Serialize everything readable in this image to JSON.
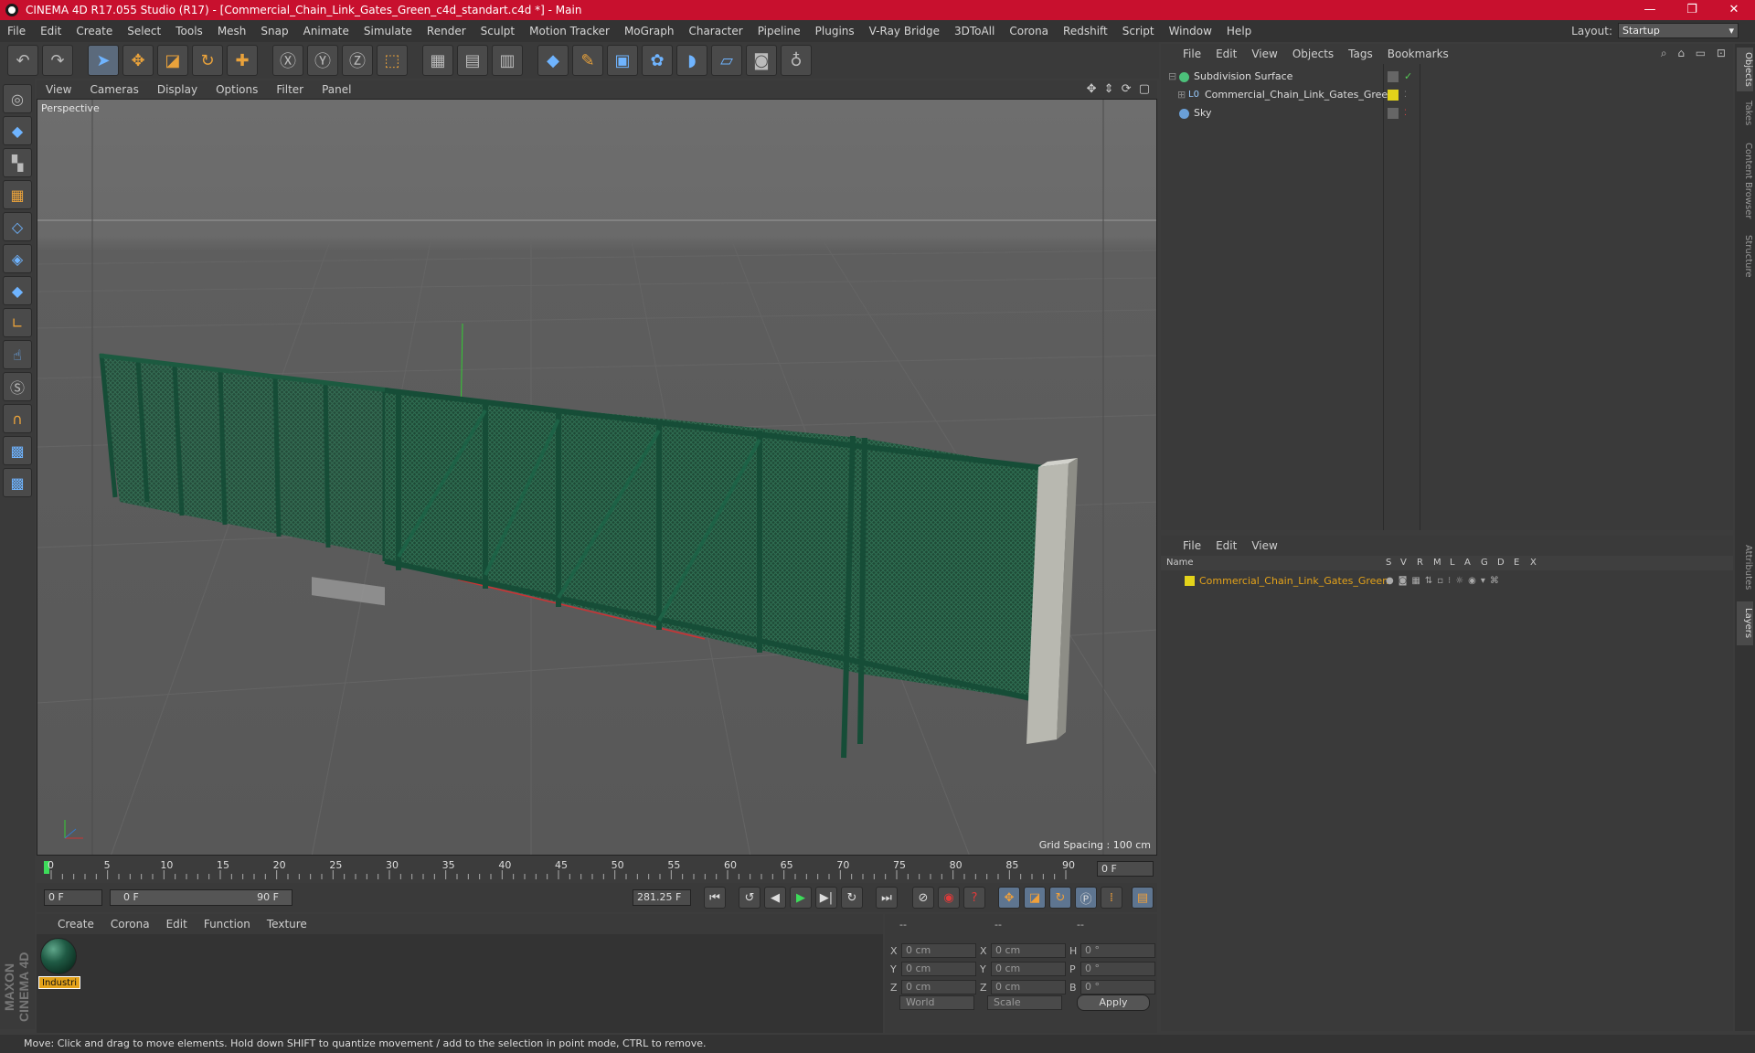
{
  "window": {
    "title": "CINEMA 4D R17.055 Studio (R17) - [Commercial_Chain_Link_Gates_Green_c4d_standart.c4d *] - Main",
    "controls": [
      "—",
      "❐",
      "✕"
    ]
  },
  "menu": [
    "File",
    "Edit",
    "Create",
    "Select",
    "Tools",
    "Mesh",
    "Snap",
    "Animate",
    "Simulate",
    "Render",
    "Sculpt",
    "Motion Tracker",
    "MoGraph",
    "Character",
    "Pipeline",
    "Plugins",
    "V-Ray Bridge",
    "3DToAll",
    "Corona",
    "Redshift",
    "Script",
    "Window",
    "Help"
  ],
  "layout": {
    "label": "Layout:",
    "value": "Startup"
  },
  "viewport": {
    "menu": [
      "View",
      "Cameras",
      "Display",
      "Options",
      "Filter",
      "Panel"
    ],
    "label": "Perspective",
    "grid_spacing": "Grid Spacing : 100 cm"
  },
  "timeline": {
    "ticks": [
      "0",
      "5",
      "10",
      "15",
      "20",
      "25",
      "30",
      "35",
      "40",
      "45",
      "50",
      "55",
      "60",
      "65",
      "70",
      "75",
      "80",
      "85",
      "90"
    ],
    "current_frame": "0 F"
  },
  "transport": {
    "start": "0 F",
    "range_start": "0 F",
    "range_end": "90 F",
    "end": "281.25 F"
  },
  "material_manager": {
    "menu": [
      "Create",
      "Corona",
      "Edit",
      "Function",
      "Texture"
    ],
    "materials": [
      {
        "label": "Industri"
      }
    ]
  },
  "coordinates": {
    "headers": [
      "--",
      "--",
      "--"
    ],
    "rows": [
      {
        "a": "X",
        "av": "0 cm",
        "b": "X",
        "bv": "0 cm",
        "c": "H",
        "cv": "0 °"
      },
      {
        "a": "Y",
        "av": "0 cm",
        "b": "Y",
        "bv": "0 cm",
        "c": "P",
        "cv": "0 °"
      },
      {
        "a": "Z",
        "av": "0 cm",
        "b": "Z",
        "bv": "0 cm",
        "c": "B",
        "cv": "0 °"
      }
    ],
    "mode1": "World",
    "mode2": "Scale",
    "apply": "Apply"
  },
  "object_manager": {
    "menu": [
      "File",
      "Edit",
      "View",
      "Objects",
      "Tags",
      "Bookmarks"
    ],
    "objects": [
      {
        "name": "Subdivision Surface"
      },
      {
        "name": "Commercial_Chain_Link_Gates_Green"
      },
      {
        "name": "Sky"
      }
    ]
  },
  "layer_manager": {
    "menu": [
      "File",
      "Edit",
      "View"
    ],
    "columns": [
      "Name",
      "S",
      "V",
      "R",
      "M",
      "L",
      "A",
      "G",
      "D",
      "E",
      "X"
    ],
    "layers": [
      {
        "name": "Commercial_Chain_Link_Gates_Green"
      }
    ]
  },
  "side_tabs": [
    "Objects",
    "Takes",
    "Content Browser",
    "Structure",
    "Attributes",
    "Layers"
  ],
  "status": "Move: Click and drag to move elements. Hold down SHIFT to quantize movement / add to the selection in point mode, CTRL to remove.",
  "brand": "MAXON CINEMA 4D",
  "colors": {
    "title_bar": "#c8102e",
    "layer_color": "#e3d31a",
    "accent": "#e9a23b"
  }
}
